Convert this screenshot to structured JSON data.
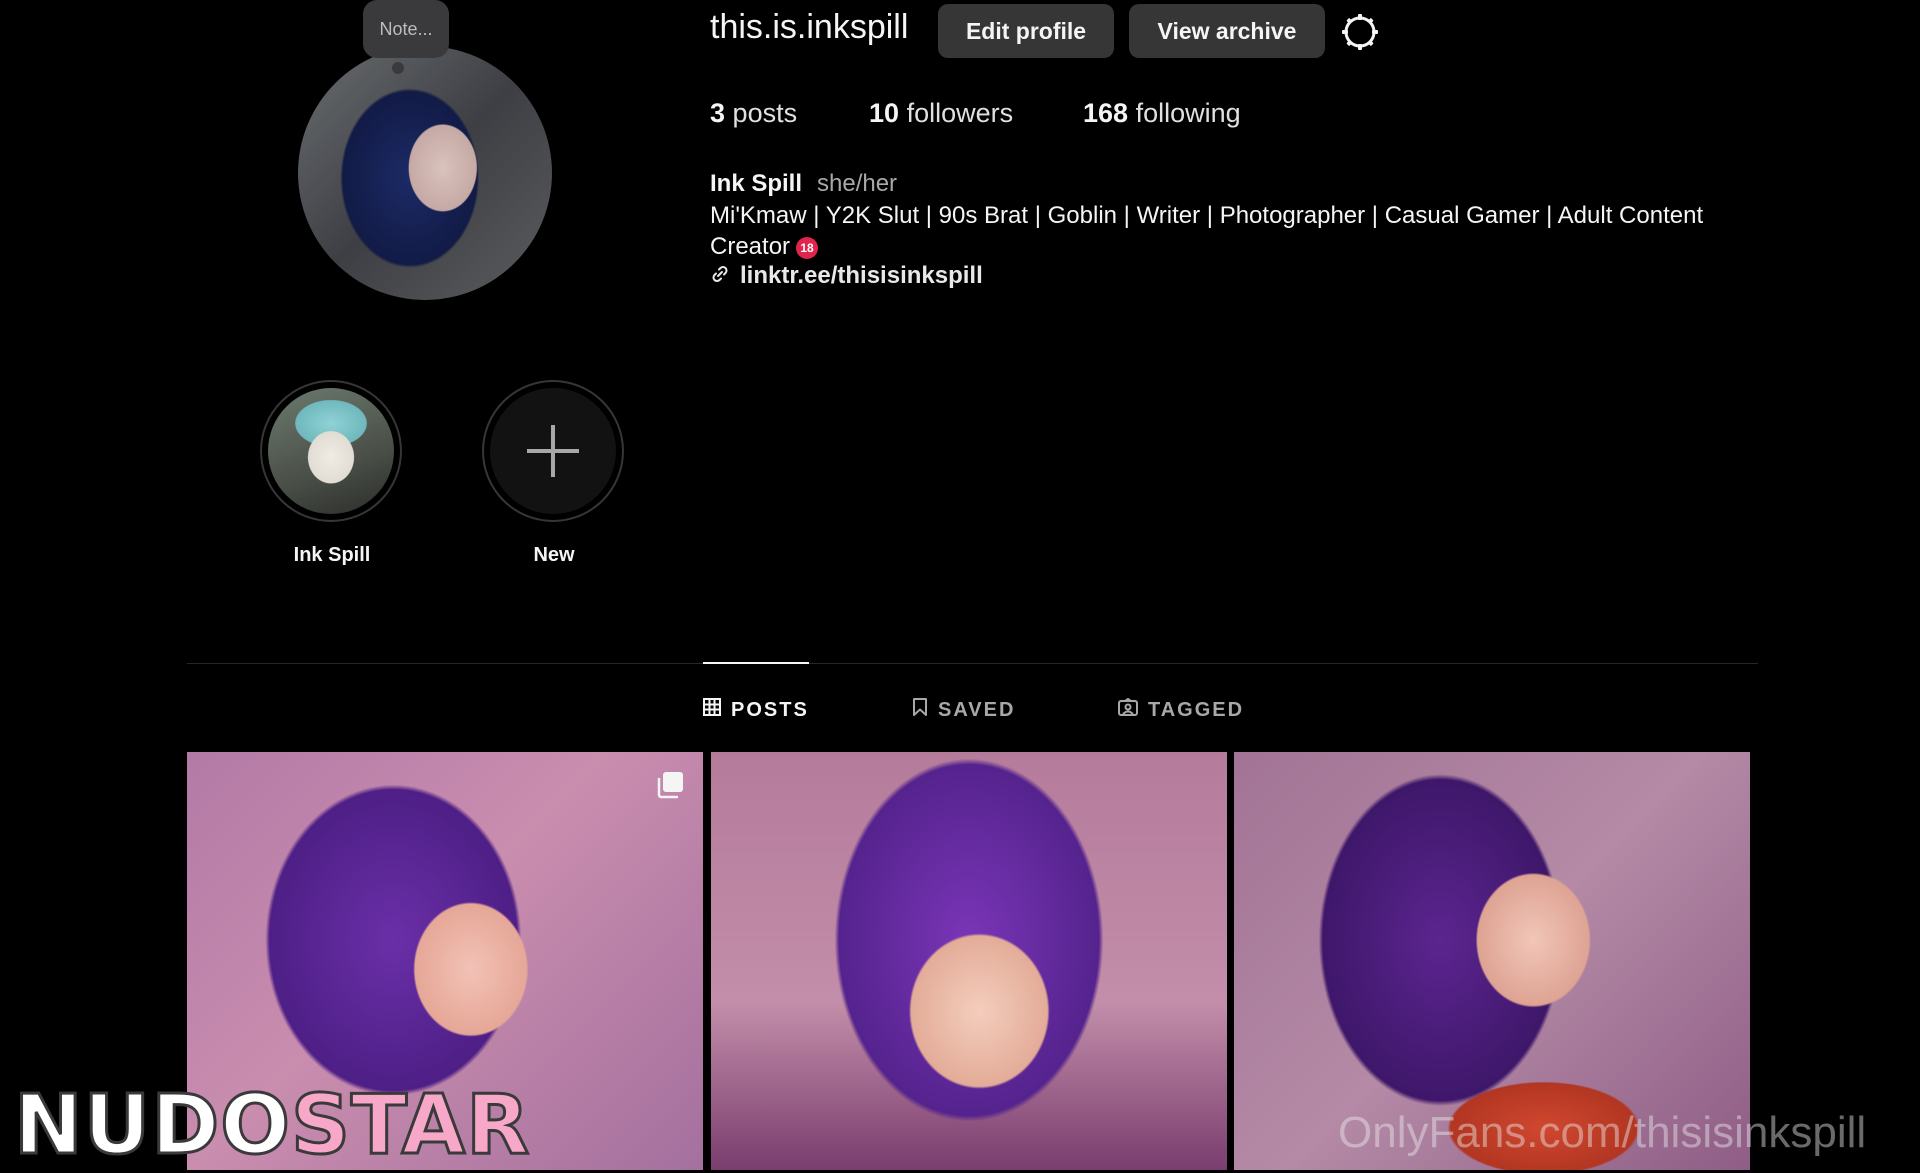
{
  "profile": {
    "note": "Note...",
    "username": "this.is.inkspill",
    "edit_label": "Edit profile",
    "archive_label": "View archive",
    "settings_icon": "gear-icon",
    "stats": {
      "posts_count": "3",
      "posts_label": "posts",
      "followers_count": "10",
      "followers_label": "followers",
      "following_count": "168",
      "following_label": "following"
    },
    "full_name": "Ink Spill",
    "pronouns": "she/her",
    "bio": "Mi'Kmaw | Y2K Slut | 90s Brat | Goblin | Writer | Photographer | Casual Gamer | Adult Content Creator",
    "bio_badge": "18",
    "link": "linktr.ee/thisisinkspill"
  },
  "highlights": [
    {
      "label": "Ink Spill"
    },
    {
      "label": "New"
    }
  ],
  "tabs": [
    {
      "label": "POSTS",
      "icon": "grid-icon",
      "active": true
    },
    {
      "label": "SAVED",
      "icon": "bookmark-icon",
      "active": false
    },
    {
      "label": "TAGGED",
      "icon": "tagged-icon",
      "active": false
    }
  ],
  "watermarks": {
    "logo_part1": "NUDO",
    "logo_part2": "STAR",
    "onlyfans": "OnlyFans.com/thisisinkspill"
  },
  "colors": {
    "background": "#000000",
    "button": "#363636",
    "muted_text": "#a8a8a8"
  }
}
